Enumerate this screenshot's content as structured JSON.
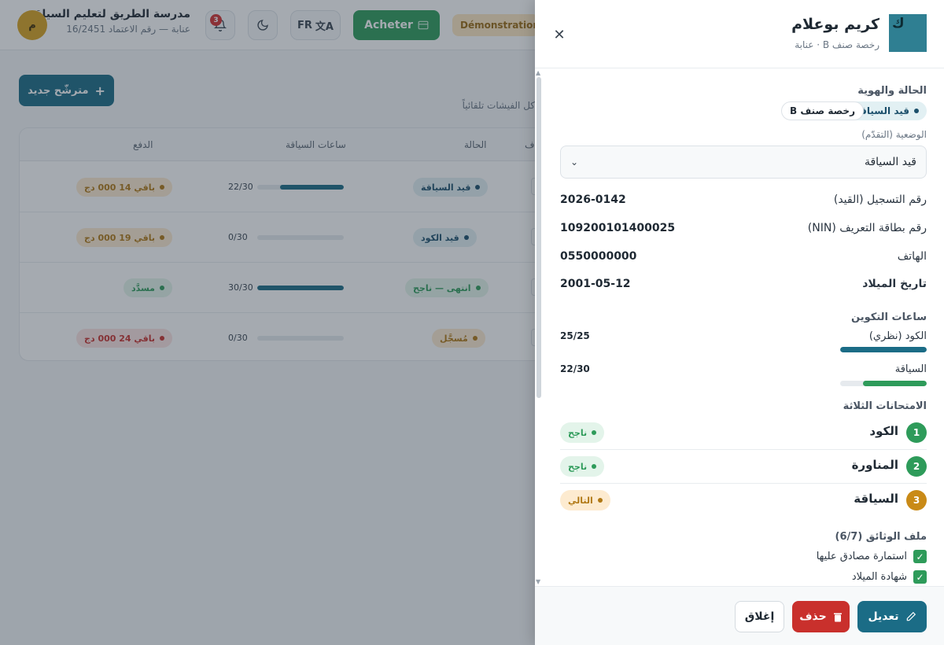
{
  "topbar": {
    "school_name": "مدرسة الطريق لتعليم السياقة",
    "school_sub": "عنابة — رقم الاعتماد 16/2451",
    "avatar_letter": "م",
    "notif_count": "3",
    "lang_label": "FR",
    "buy_label": "Acheter",
    "demo_label": "Démonstration"
  },
  "page": {
    "new_button": "مترشّح جديد",
    "hint_text": "كل الفيشات تلقائياً"
  },
  "table": {
    "headers": [
      "ف",
      "الحالة",
      "ساعات السياقة",
      "الدفع"
    ],
    "rows": [
      {
        "status": "قيد السياقة",
        "status_color": "#1b4f6b",
        "hours": "22/30",
        "hours_fraction": 0.733,
        "payment": "باقي 14 000 دج",
        "pay_color": "#b07814"
      },
      {
        "status": "قيد الكود",
        "status_color": "#1b4f6b",
        "hours": "0/30",
        "hours_fraction": 0,
        "payment": "باقي 19 000 دج",
        "pay_color": "#b07814"
      },
      {
        "status": "انتهى — ناجح",
        "status_color": "#2e9b5a",
        "hours": "30/30",
        "hours_fraction": 1,
        "payment": "مسدَّد",
        "pay_color": "#2e9b5a"
      },
      {
        "status": "مُسجَّل",
        "status_color": "#b07814",
        "hours": "0/30",
        "hours_fraction": 0,
        "payment": "باقي 24 000 دج",
        "pay_color": "#c9302c"
      }
    ]
  },
  "drawer": {
    "avatar_letter": "ك",
    "name": "كريم بوعلام",
    "subtitle": "رخصة صنف B · عنابة",
    "status_section": "الحالة والهوية",
    "tag_status": "قيد السياقة",
    "tag_license": "رخصة صنف B",
    "position_label": "الوضعية (التقدّم)",
    "position_value": "قيد السياقة",
    "fields": [
      {
        "label": "رقم التسجيل (القيد)",
        "value": "2026-0142"
      },
      {
        "label": "رقم بطاقة التعريف (NIN)",
        "value": "109200101400025"
      },
      {
        "label": "الهاتف",
        "value": "0550000000"
      },
      {
        "label": "تاريخ الميلاد",
        "value": "2001-05-12"
      }
    ],
    "training_title": "ساعات التكوين",
    "training": [
      {
        "label": "الكود (نظري)",
        "value": "25/25",
        "fraction": 1.0,
        "color": "#1b6c86"
      },
      {
        "label": "السياقة",
        "value": "22/30",
        "fraction": 0.733,
        "color": "#2e9b5a"
      }
    ],
    "exams_title": "الامتحانات الثلاثة",
    "exams": [
      {
        "num": "1",
        "name": "الكود",
        "status": "ناجح",
        "num_color": "#2e9b5a",
        "st_bg": "#e3f4ea",
        "st_color": "#2e9b5a"
      },
      {
        "num": "2",
        "name": "المناورة",
        "status": "ناجح",
        "num_color": "#2e9b5a",
        "st_bg": "#e3f4ea",
        "st_color": "#2e9b5a"
      },
      {
        "num": "3",
        "name": "السياقة",
        "status": "التالي",
        "num_color": "#c98a17",
        "st_bg": "#fdebd0",
        "st_color": "#b07814"
      }
    ],
    "docs_title": "ملف الوثائق (6/7)",
    "docs": [
      "استمارة مصادق عليها",
      "شهادة الميلاد"
    ],
    "edit_label": "تعديل",
    "delete_label": "حذف",
    "close_label": "إغلاق"
  },
  "colors": {
    "primary": "#1b6c86",
    "success": "#2e9b5a",
    "danger": "#c9302c",
    "warning": "#c98a17"
  }
}
